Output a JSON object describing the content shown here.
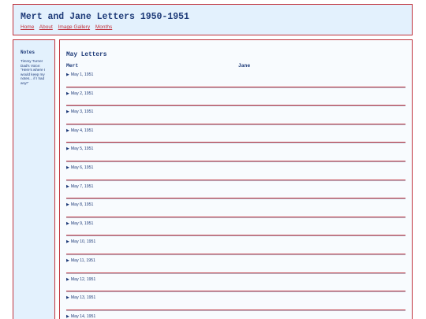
{
  "header": {
    "title": "Mert and Jane Letters 1950-1951",
    "nav": [
      "Home",
      "About",
      "Image Gallery",
      "Months"
    ]
  },
  "sidebar": {
    "heading": "Notes",
    "text": "Timmy Turner Dad's Voice: \"Here's where I would keep my notes... if I had any!\""
  },
  "main": {
    "title": "May Letters",
    "columns": [
      "Mert",
      "Jane"
    ],
    "letters": [
      "May 1, 1951",
      "May 2, 1951",
      "May 3, 1951",
      "May 4, 1951",
      "May 5, 1951",
      "May 6, 1951",
      "May 7, 1951",
      "May 8, 1951",
      "May 9, 1951",
      "May 10, 1951",
      "May 11, 1951",
      "May 12, 1951",
      "May 13, 1951",
      "May 14, 1951"
    ]
  },
  "icons": {
    "expand": "triangle-right-icon"
  },
  "colors": {
    "accent": "#c0323c",
    "text": "#1d3a78",
    "panel": "#e3f1fd"
  }
}
